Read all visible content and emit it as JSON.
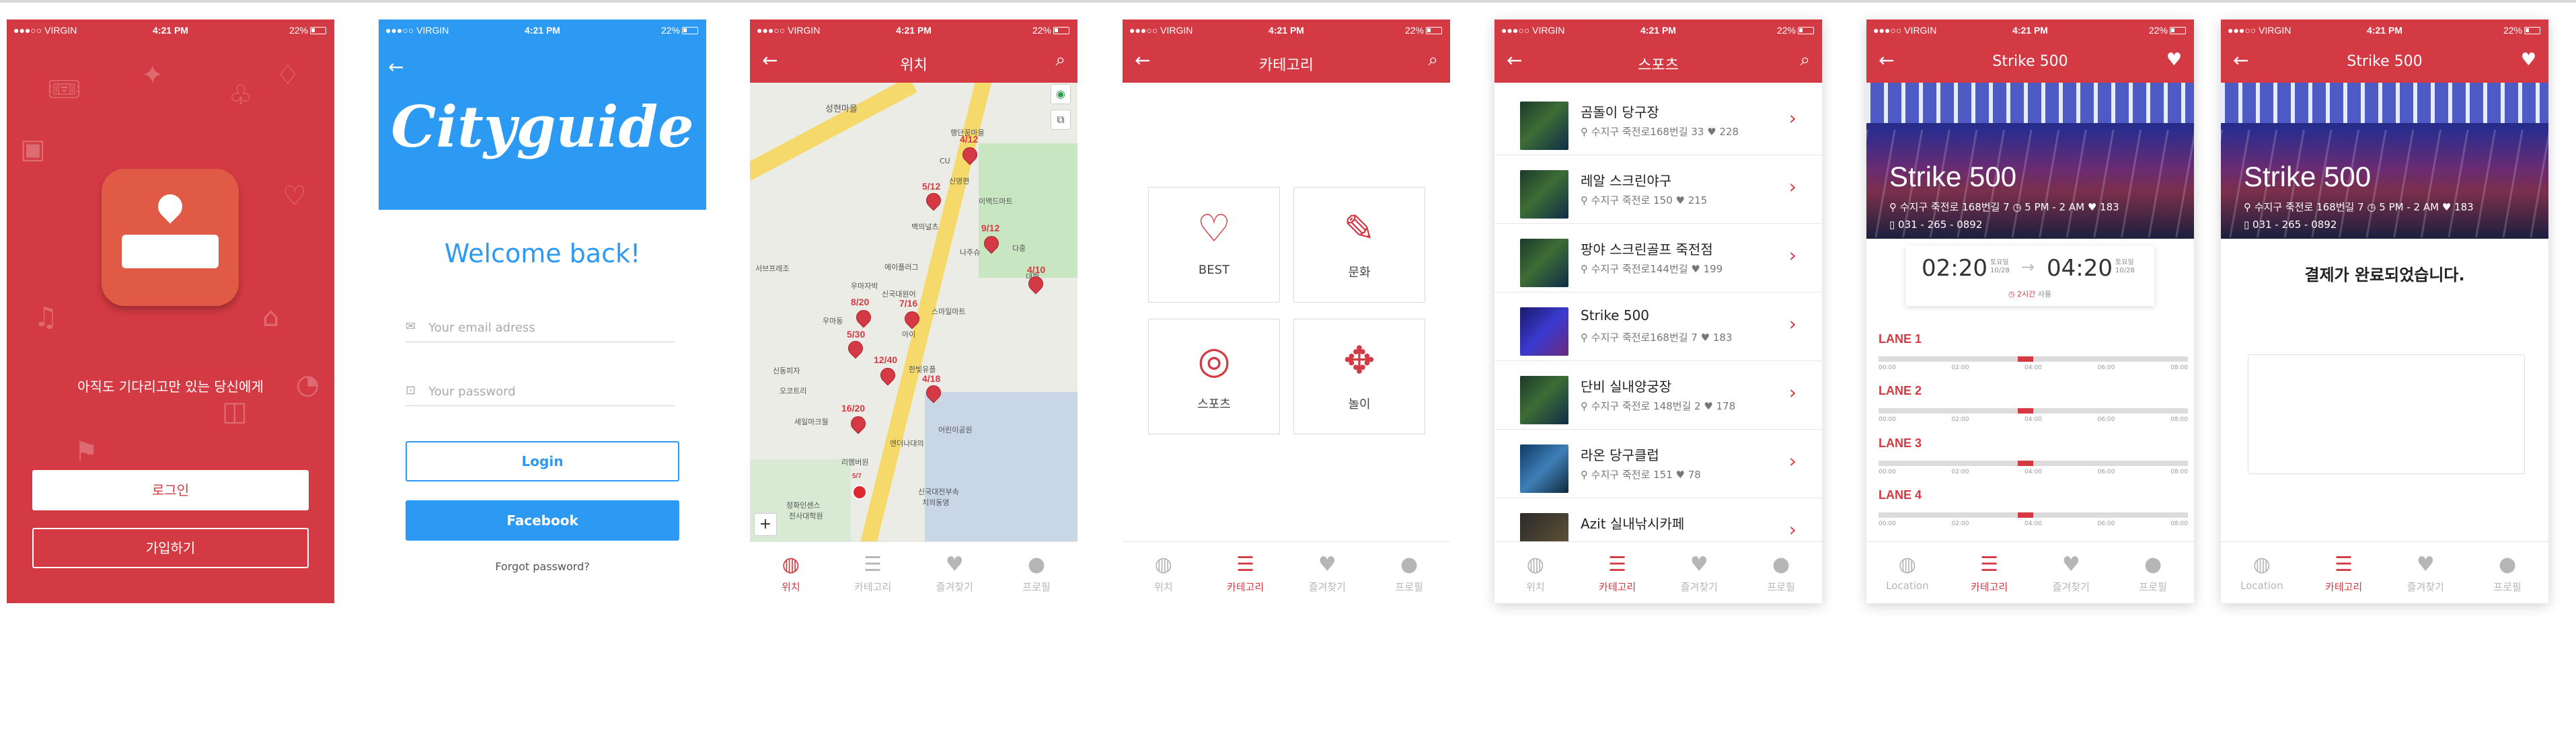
{
  "status": {
    "carrier": "●●●○○ VIRGIN",
    "time": "4:21 PM",
    "battery": "22%"
  },
  "screen1": {
    "tagline": "아직도 기다리고만 있는 당신에게",
    "login_label": "로그인",
    "signup_label": "가입하기"
  },
  "screen2": {
    "logo_text": "Cityguide",
    "welcome": "Welcome back!",
    "email_placeholder": "Your email adress",
    "password_placeholder": "Your password",
    "login_button": "Login",
    "facebook_button": "Facebook",
    "forgot": "Forgot password?"
  },
  "screen3": {
    "title": "위치",
    "area_labels": [
      "성현마을",
      "행단꿈마을",
      "CU",
      "신영편",
      "이맥드마트",
      "백의널츠",
      "나주슈",
      "다중",
      "아이",
      "스마일마트",
      "우마동",
      "한빛유플",
      "신동피자",
      "오코트리",
      "에이플러그",
      "엔더나대의",
      "세일마크월",
      "서브프레조",
      "신국대원어",
      "어린이공원",
      "대학",
      "정화인센스",
      "전사대학원",
      "신국대전부속",
      "치의동영",
      "우마자박",
      "리멤버원"
    ],
    "pin_labels": [
      "4/12",
      "5/12",
      "9/12",
      "4/10",
      "8/20",
      "7/16",
      "5/30",
      "12/40",
      "4/18",
      "16/20",
      "5/7"
    ],
    "tabs": [
      "위치",
      "카테고리",
      "즐겨찾기",
      "프로필"
    ]
  },
  "screen4": {
    "title": "카테고리",
    "categories": [
      "BEST",
      "문화",
      "스포츠",
      "놀이"
    ],
    "tabs": [
      "위치",
      "카테고리",
      "즐겨찾기",
      "프로필"
    ]
  },
  "screen5": {
    "title": "스포츠",
    "items": [
      {
        "name": "곰돌이 당구장",
        "address": "수지구 죽전로168번길 33",
        "likes": "228"
      },
      {
        "name": "레알 스크린야구",
        "address": "수지구 죽전로 150",
        "likes": "215"
      },
      {
        "name": "팡야 스크린골프 죽전점",
        "address": "수지구 죽전로144번길",
        "likes": "199"
      },
      {
        "name": "Strike 500",
        "address": "수지구 죽전로168번길 7",
        "likes": "183"
      },
      {
        "name": "단비 실내양궁장",
        "address": "수지구 죽전로 148번길 2",
        "likes": "178"
      },
      {
        "name": "라온 당구클럽",
        "address": "수지구 죽전로 151",
        "likes": "78"
      },
      {
        "name": "Azit 실내낚시카페",
        "address": "",
        "likes": ""
      }
    ],
    "tabs": [
      "위치",
      "카테고리",
      "즐겨찾기",
      "프로필"
    ]
  },
  "screen6": {
    "title": "Strike 500",
    "venue": "Strike 500",
    "address": "수지구 죽전로 168번길 7",
    "hours": "5 PM - 2 AM",
    "likes": "183",
    "phone": "031 - 265 - 0892",
    "start_time": "02:20",
    "start_label": "토요일",
    "start_date": "10/28",
    "end_time": "04:20",
    "end_label": "토요일",
    "end_date": "10/28",
    "duration": "2시간",
    "duration_note": "사용",
    "lanes": [
      "LANE 1",
      "LANE 2",
      "LANE 3",
      "LANE 4"
    ],
    "lane_ticks": [
      "00:00",
      "02:00",
      "04:00",
      "06:00",
      "08:00"
    ],
    "tabs": [
      "Location",
      "카테고리",
      "즐겨찾기",
      "프로필"
    ]
  },
  "screen7": {
    "title": "Strike 500",
    "venue": "Strike 500",
    "address": "수지구 죽전로 168번길 7",
    "hours": "5 PM - 2 AM",
    "likes": "183",
    "phone": "031 - 265 - 0892",
    "confirmation": "결제가 완료되었습니다.",
    "tabs": [
      "Location",
      "카테고리",
      "즐겨찾기",
      "프로필"
    ]
  },
  "colors": {
    "primary_red": "#d43a43",
    "blue": "#2c9af2",
    "facebook": "#2c9af2"
  }
}
